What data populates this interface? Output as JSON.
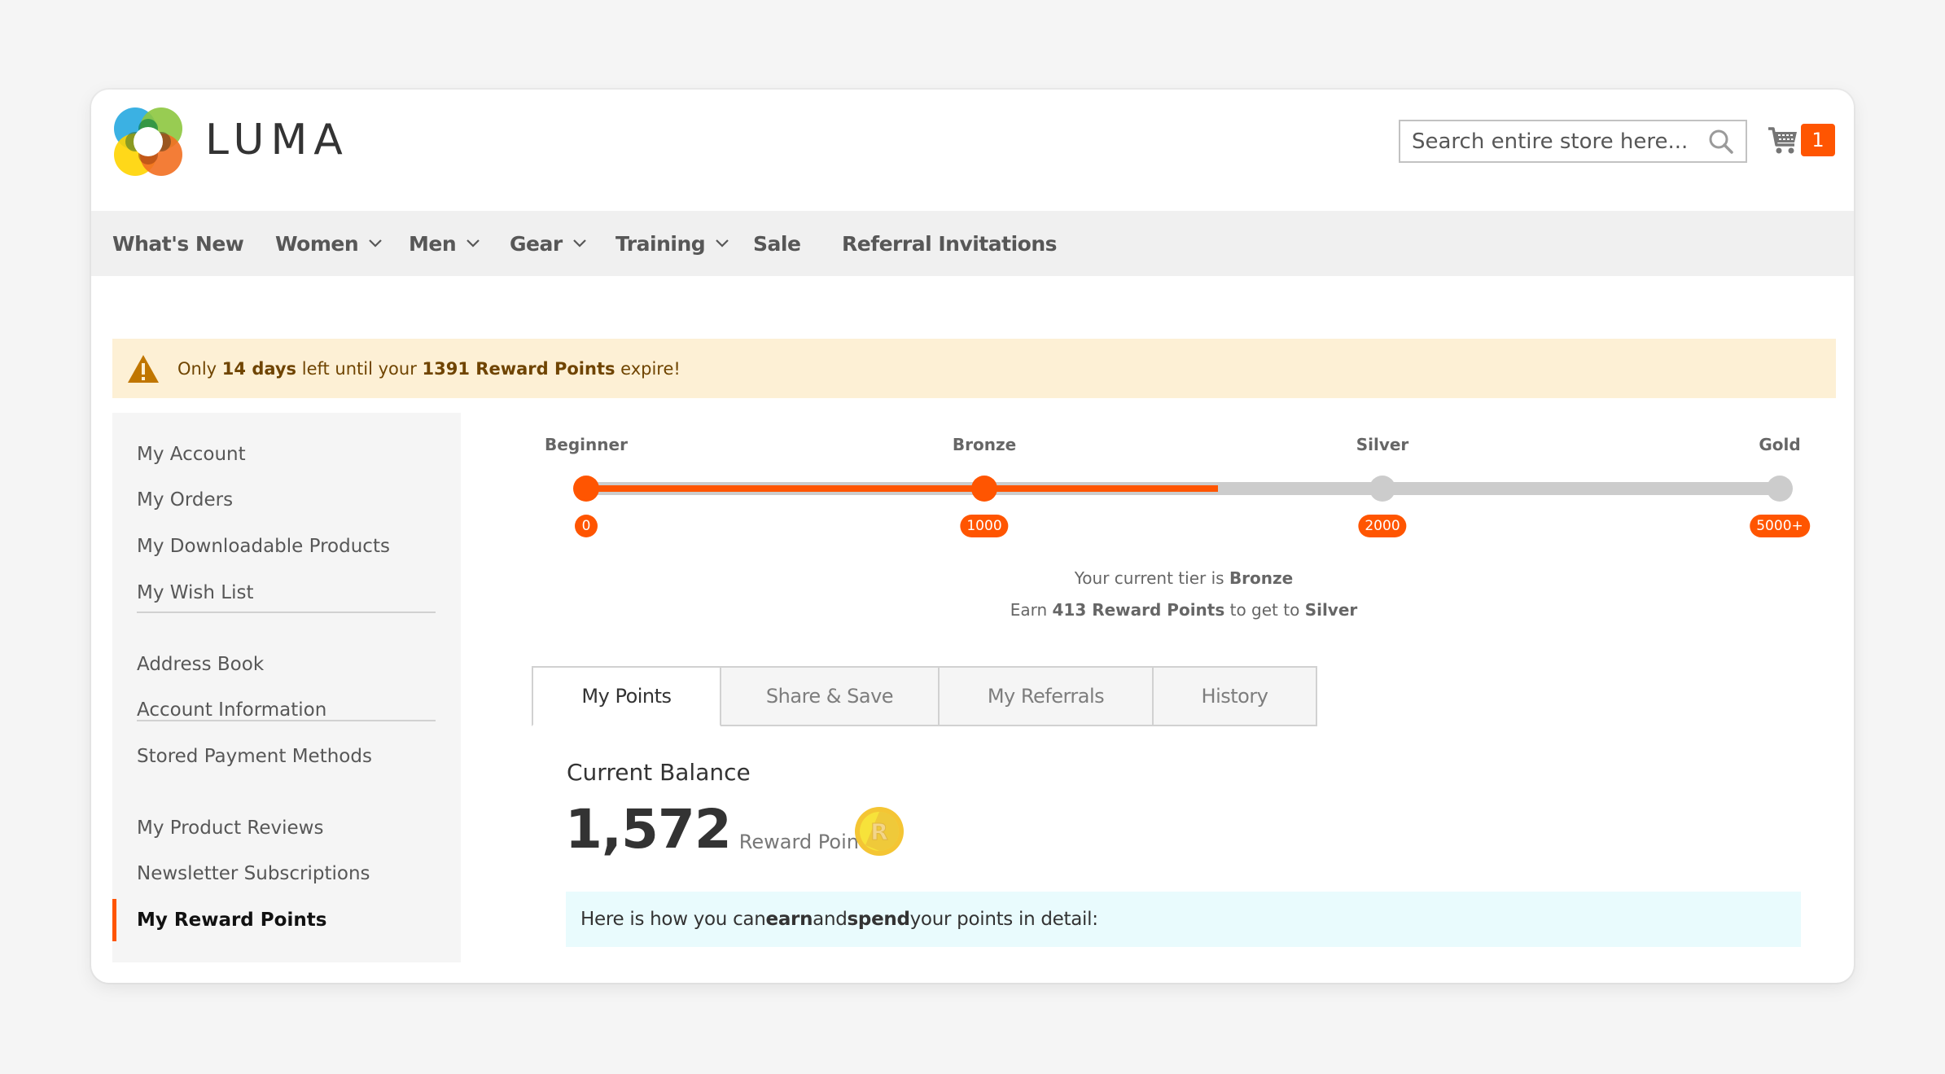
{
  "header": {
    "brand": "LUMA",
    "search": {
      "placeholder": "Search entire store here..."
    },
    "cart": {
      "count": "1"
    }
  },
  "nav": {
    "items": [
      {
        "label": "What's New",
        "dropdown": false
      },
      {
        "label": "Women",
        "dropdown": true
      },
      {
        "label": "Men",
        "dropdown": true
      },
      {
        "label": "Gear",
        "dropdown": true
      },
      {
        "label": "Training",
        "dropdown": true
      },
      {
        "label": "Sale",
        "dropdown": false
      },
      {
        "label": "Referral Invitations",
        "dropdown": false
      }
    ]
  },
  "alert": {
    "prefix": "Only ",
    "days": "14 days",
    "middle": " left until your ",
    "points": "1391 Reward Points",
    "suffix": " expire!"
  },
  "sidebar": {
    "groups": [
      [
        "My Account",
        "My Orders",
        "My Downloadable Products",
        "My Wish List"
      ],
      [
        "Address Book",
        "Account Information",
        "Stored Payment Methods"
      ],
      [
        "My Product Reviews",
        "Newsletter Subscriptions",
        "My Reward Points"
      ]
    ],
    "items": [
      "My Account",
      "My Orders",
      "My Downloadable Products",
      "My Wish List",
      "Address Book",
      "Account Information",
      "Stored Payment Methods",
      "My Product Reviews",
      "Newsletter Subscriptions",
      "My Reward Points"
    ],
    "active": "My Reward Points"
  },
  "tiers": {
    "levels": [
      {
        "name": "Beginner",
        "threshold": "0",
        "reached": true
      },
      {
        "name": "Bronze",
        "threshold": "1000",
        "reached": true
      },
      {
        "name": "Silver",
        "threshold": "2000",
        "reached": false
      },
      {
        "name": "Gold",
        "threshold": "5000+",
        "reached": false
      }
    ],
    "progress_points": 1587,
    "current_tier_prefix": "Your current tier is ",
    "current_tier": "Bronze",
    "earn_prefix": "Earn ",
    "earn_points": "413 Reward Points",
    "earn_middle": " to get to ",
    "next_tier": "Silver"
  },
  "tabs": [
    {
      "label": "My Points",
      "active": true
    },
    {
      "label": "Share & Save",
      "active": false
    },
    {
      "label": "My Referrals",
      "active": false
    },
    {
      "label": "History",
      "active": false
    }
  ],
  "balance": {
    "title": "Current Balance",
    "value": "1,572",
    "unit": "Reward Points",
    "coin_letter": "R"
  },
  "info": {
    "prefix": "Here is how you can ",
    "earn": "earn",
    "middle": " and ",
    "spend": "spend",
    "suffix": " your points in detail:"
  },
  "colors": {
    "accent": "#ff5501",
    "alert_bg": "#fdf0d5",
    "alert_icon": "#c07600",
    "info_bg": "#e9fbfd",
    "track": "#cccccc"
  }
}
